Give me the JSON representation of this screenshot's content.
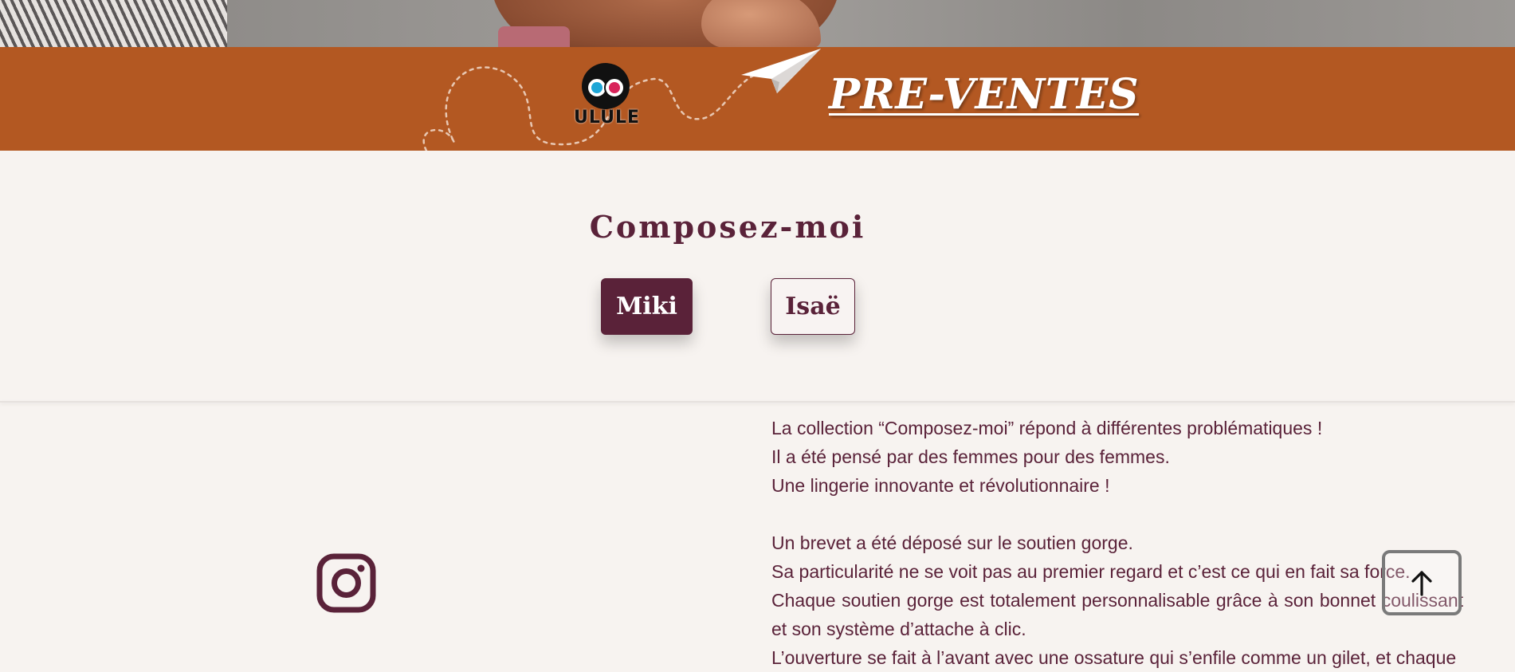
{
  "banner": {
    "ulule_logo_text": "ULULE",
    "preventes_link": "PRE-VENTES",
    "background_color": "#b35822"
  },
  "compose": {
    "title": "Composez-moi",
    "options": [
      {
        "label": "Miki",
        "selected": true
      },
      {
        "label": "Isaë",
        "selected": false
      }
    ],
    "accent_color": "#5a2239"
  },
  "social": {
    "icon": "instagram-icon"
  },
  "description": {
    "lines": [
      "La collection “Composez-moi” répond à différentes problématiques !",
      "Il a été pensé par des femmes pour des femmes.",
      "Une lingerie innovante et révolutionnaire !",
      "Un brevet a été déposé sur le soutien gorge.",
      "Sa particularité ne se voit pas au premier regard et c’est ce qui en fait sa force.",
      "Chaque soutien gorge est totalement personnalisable grâce à son bonnet coulissant et son système d’attache à clic.",
      "L’ouverture se fait à l’avant avec une ossature qui s’enfile comme un gilet, et chaque"
    ]
  },
  "scroll_top": {
    "icon": "arrow-up-icon"
  }
}
